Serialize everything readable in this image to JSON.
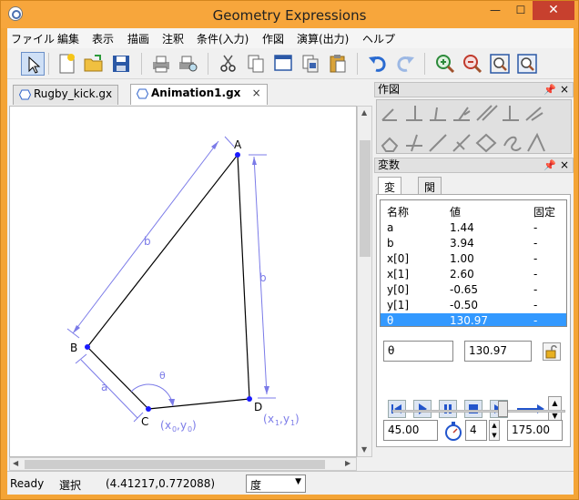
{
  "window": {
    "title": "Geometry Expressions",
    "minimize": "—",
    "maximize": "☐",
    "close": "✕"
  },
  "menu": [
    "ファイル",
    "編集",
    "表示",
    "描画",
    "注釈",
    "条件(入力)",
    "作図",
    "演算(出力)",
    "ヘルプ"
  ],
  "toolbar_icons": [
    "select-arrow-icon",
    "new-file-icon",
    "open-folder-icon",
    "save-disk-icon",
    "print-icon",
    "print-preview-icon",
    "cut-scissors-icon",
    "copy-icon",
    "copy-picture-icon",
    "copy-special-icon",
    "paste-icon",
    "undo-icon",
    "redo-icon",
    "zoom-in-icon",
    "zoom-out-icon",
    "zoom-fit-icon",
    "zoom-window-icon"
  ],
  "doc_tabs": [
    {
      "label": "Rugby_kick.gx",
      "active": false
    },
    {
      "label": "Animation1.gx",
      "active": true,
      "close": "×"
    }
  ],
  "drawing": {
    "points": {
      "A": "A",
      "B": "B",
      "C": "C",
      "D": "D"
    },
    "labels": {
      "b_left": "b",
      "b_right": "b",
      "a": "a",
      "theta": "θ",
      "x0": "x",
      "x0_sub": "0",
      "y0": "y",
      "y0_sub": "0",
      "x1": "x",
      "x1_sub": "1",
      "y1": "y",
      "y1_sub": "1"
    },
    "colors": {
      "figure": "#000000",
      "annotation": "#7b7be8",
      "point": "#1a1aff"
    }
  },
  "construct_panel": {
    "title": "作図",
    "pin": "ᵖ",
    "close": "×"
  },
  "variables_panel": {
    "title": "変数",
    "tabs": [
      {
        "label": "変数",
        "active": true
      },
      {
        "label": "関数",
        "active": false
      }
    ],
    "columns": [
      "名称",
      "値",
      "固定"
    ],
    "rows": [
      {
        "name": "a",
        "value": "1.44",
        "fixed": "-"
      },
      {
        "name": "b",
        "value": "3.94",
        "fixed": "-"
      },
      {
        "name": "x[0]",
        "value": "1.00",
        "fixed": "-"
      },
      {
        "name": "x[1]",
        "value": "2.60",
        "fixed": "-"
      },
      {
        "name": "y[0]",
        "value": "-0.65",
        "fixed": "-"
      },
      {
        "name": "y[1]",
        "value": "-0.50",
        "fixed": "-"
      },
      {
        "name": "θ",
        "value": "130.97",
        "fixed": "-",
        "selected": true
      }
    ],
    "selected_name": "θ",
    "selected_value": "130.97",
    "anim_start": "45.00",
    "anim_speed": "4",
    "anim_end": "175.00",
    "slider_position": 0.64
  },
  "status": {
    "ready": "Ready",
    "mode": "選択",
    "coords": "(4.41217,0.772088)",
    "unit": "度"
  }
}
